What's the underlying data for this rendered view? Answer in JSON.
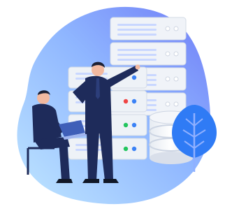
{
  "illustration": {
    "subject": "data-center-servers",
    "icons": [
      "server-rack-icon",
      "database-icon",
      "leaf-icon",
      "laptop-icon"
    ],
    "colors": {
      "blob_start": "#bfe6ff",
      "blob_end": "#6f7cf7",
      "server_body": "#e9edf3",
      "server_edge": "#cfd6e2",
      "server_line": "#c7d6ff",
      "led_blue": "#3b82f6",
      "led_red": "#ef4444",
      "led_green": "#22c55e",
      "suit": "#1e2b5a",
      "skin": "#f2b9a0",
      "leaf": "#2f7bf5",
      "stem": "#7b8fc6"
    }
  }
}
